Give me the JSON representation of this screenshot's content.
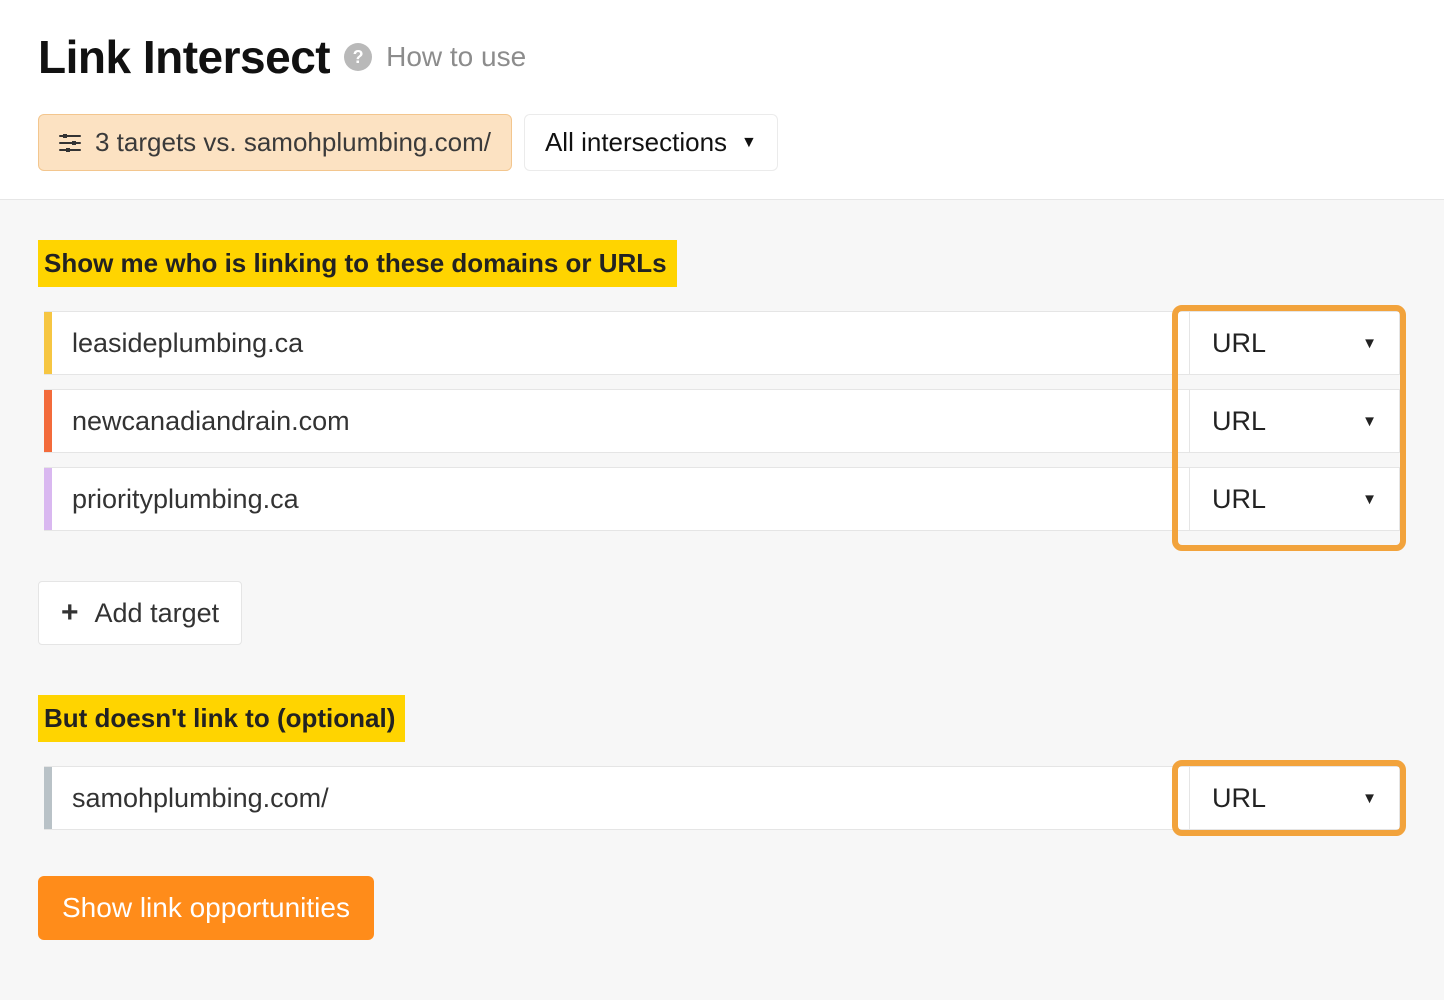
{
  "header": {
    "title": "Link Intersect",
    "help_glyph": "?",
    "how_to_use": "How to use",
    "targets_chip": "3 targets vs. samohplumbing.com/",
    "intersections_label": "All intersections"
  },
  "section1": {
    "label": "Show me who is linking to these domains or URLs",
    "rows": [
      {
        "value": "leasideplumbing.ca",
        "type": "URL",
        "color": "c-yellow"
      },
      {
        "value": "newcanadiandrain.com",
        "type": "URL",
        "color": "c-orange"
      },
      {
        "value": "priorityplumbing.ca",
        "type": "URL",
        "color": "c-purple"
      }
    ],
    "add_target": "Add target"
  },
  "section2": {
    "label": "But doesn't link to (optional)",
    "row": {
      "value": "samohplumbing.com/",
      "type": "URL",
      "color": "c-grey"
    }
  },
  "actions": {
    "show_opportunities": "Show link opportunities"
  },
  "glyphs": {
    "caret": "▼",
    "plus": "+"
  }
}
